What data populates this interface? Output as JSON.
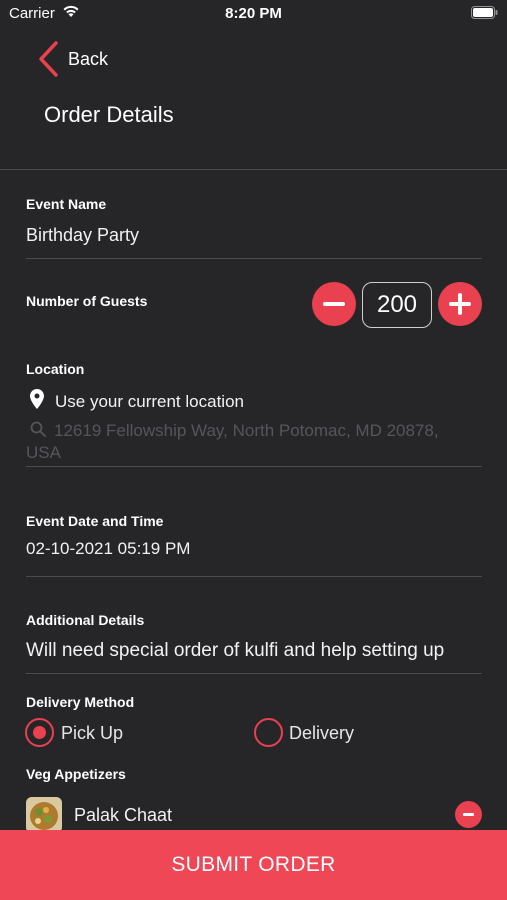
{
  "status_bar": {
    "carrier": "Carrier",
    "time": "8:20 PM"
  },
  "nav": {
    "back_label": "Back",
    "title": "Order Details"
  },
  "form": {
    "event_name": {
      "label": "Event Name",
      "value": "Birthday Party"
    },
    "guests": {
      "label": "Number of Guests",
      "value": "200"
    },
    "location": {
      "label": "Location",
      "use_current": "Use your current location",
      "placeholder": "12619 Fellowship Way, North Potomac, MD 20878, USA"
    },
    "event_datetime": {
      "label": "Event Date and Time",
      "value": "02-10-2021 05:19 PM"
    },
    "additional_details": {
      "label": "Additional Details",
      "value": "Will need special order of kulfi and help setting up"
    },
    "delivery_method": {
      "label": "Delivery Method",
      "options": [
        {
          "label": "Pick Up",
          "selected": true
        },
        {
          "label": "Delivery",
          "selected": false
        }
      ]
    }
  },
  "menu": {
    "category": "Veg Appetizers",
    "items": [
      {
        "name": "Palak Chaat",
        "icon": "minus-icon"
      }
    ]
  },
  "submit_label": "SUBMIT ORDER",
  "colors": {
    "background": "#262629",
    "accent": "#ef4756",
    "divider": "#4a4a4f"
  }
}
